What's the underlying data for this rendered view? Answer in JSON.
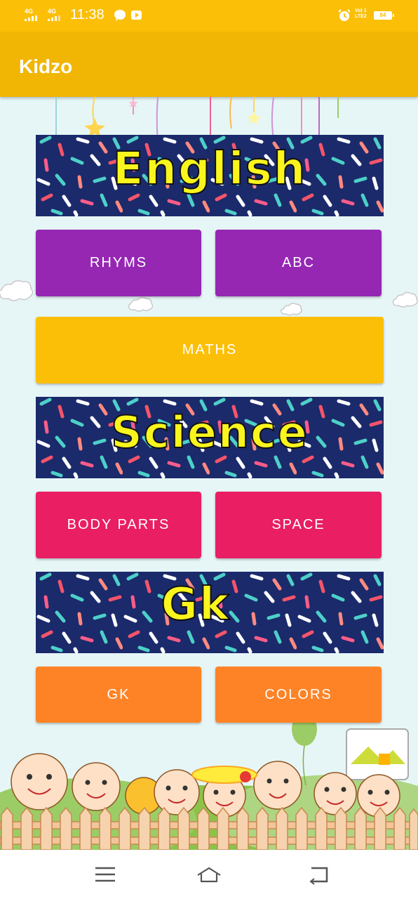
{
  "status_bar": {
    "net1": "4G",
    "net2": "4G",
    "time": "11:38",
    "volte_line1": "Vo) 1",
    "volte_line2": "LTE2",
    "battery": "84"
  },
  "app_bar": {
    "title": "Kidzo"
  },
  "sections": {
    "english_banner": "English",
    "science_banner": "Science",
    "gk_banner": "Gk"
  },
  "buttons": {
    "rhyms": "RHYMS",
    "abc": "ABC",
    "maths": "MATHS",
    "body_parts": "BODY PARTS",
    "space": "SPACE",
    "gk": "GK",
    "colors": "COLORS"
  },
  "colors": {
    "status_bar": "#fcbf07",
    "app_bar": "#f1b503",
    "purple_button": "#9527b3",
    "yellow_button": "#fcbf07",
    "pink_button": "#e91e63",
    "orange_button": "#fe8327",
    "banner_background": "#1b2a6b",
    "banner_text": "#f9f51d"
  }
}
